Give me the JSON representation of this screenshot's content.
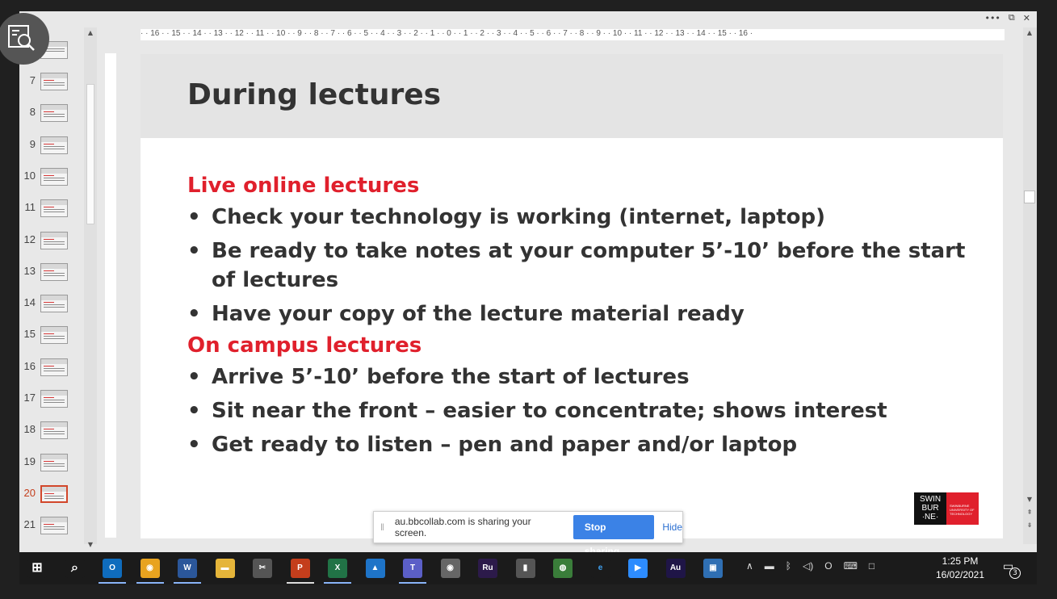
{
  "window": {
    "more_icon": "more-icon",
    "restore_icon": "restore-icon",
    "close_icon": "close-icon",
    "more_glyph": "•••",
    "restore_glyph": "⧉",
    "close_glyph": "✕"
  },
  "thumbnails": {
    "items": [
      {
        "num": "7"
      },
      {
        "num": "8"
      },
      {
        "num": "9"
      },
      {
        "num": "10"
      },
      {
        "num": "11"
      },
      {
        "num": "12"
      },
      {
        "num": "13"
      },
      {
        "num": "14"
      },
      {
        "num": "15"
      },
      {
        "num": "16"
      },
      {
        "num": "17"
      },
      {
        "num": "18"
      },
      {
        "num": "19"
      },
      {
        "num": "20",
        "selected": true
      },
      {
        "num": "21"
      }
    ]
  },
  "ruler": {
    "labels": "· · 16 · · 15 · · 14 · · 13 · · 12 · · 11 · · 10 · · 9 · · 8 · · 7 · · 6 · · 5 · · 4 · · 3 · · 2 · · 1 · · 0 · · 1 · · 2 · · 3 · · 4 · · 5 · · 6 · · 7 · · 8 · · 9 · · 10 · · 11 · · 12 · · 13 · · 14 · · 15 · · 16 ·"
  },
  "slide": {
    "title": "During lectures",
    "section1": {
      "heading": "Live online lectures",
      "bullets": [
        "Check your technology is working (internet, laptop)",
        "Be ready to take notes at your computer 5’-10’ before the start of lectures",
        "Have your copy of the lecture material ready"
      ]
    },
    "section2": {
      "heading": "On campus lectures",
      "bullets": [
        "Arrive 5’-10’ before the start of lectures",
        "Sit near the front – easier to concentrate; shows interest",
        "Get ready to listen – pen and paper and/or laptop"
      ]
    },
    "logo": {
      "left_text": "SWIN BUR ·NE·",
      "right_text": "SWINBURNE UNIVERSITY OF TECHNOLOGY"
    },
    "accent_color": "#e0202c"
  },
  "share": {
    "message": "au.bbcollab.com is sharing your screen.",
    "stop_label": "Stop sharing",
    "hide_label": "Hide"
  },
  "taskbar": {
    "apps": [
      {
        "icon": "windows-start-icon",
        "glyph": "⊞"
      },
      {
        "icon": "search-icon",
        "glyph": "⌕"
      },
      {
        "icon": "outlook-icon",
        "glyph": "O"
      },
      {
        "icon": "chrome-icon",
        "glyph": "◉"
      },
      {
        "icon": "word-icon",
        "glyph": "W"
      },
      {
        "icon": "file-explorer-icon",
        "glyph": "▬"
      },
      {
        "icon": "snipping-tool-icon",
        "glyph": "✂"
      },
      {
        "icon": "powerpoint-icon",
        "glyph": "P"
      },
      {
        "icon": "excel-icon",
        "glyph": "X"
      },
      {
        "icon": "onedrive-icon",
        "glyph": "▲"
      },
      {
        "icon": "teams-icon",
        "glyph": "T"
      },
      {
        "icon": "camera-icon",
        "glyph": "◉"
      },
      {
        "icon": "adobe-rush-icon",
        "glyph": "Ru"
      },
      {
        "icon": "microphone-icon",
        "glyph": "▮"
      },
      {
        "icon": "globe-icon",
        "glyph": "◍"
      },
      {
        "icon": "internet-explorer-icon",
        "glyph": "e"
      },
      {
        "icon": "zoom-icon",
        "glyph": "▶"
      },
      {
        "icon": "adobe-audition-icon",
        "glyph": "Au"
      },
      {
        "icon": "photos-icon",
        "glyph": "▣"
      }
    ],
    "tray": [
      "∧",
      "▬",
      "ᛒ",
      "◁)",
      "O",
      "⌨",
      "□"
    ],
    "time": "1:25 PM",
    "date": "16/02/2021",
    "notifications": "3"
  }
}
